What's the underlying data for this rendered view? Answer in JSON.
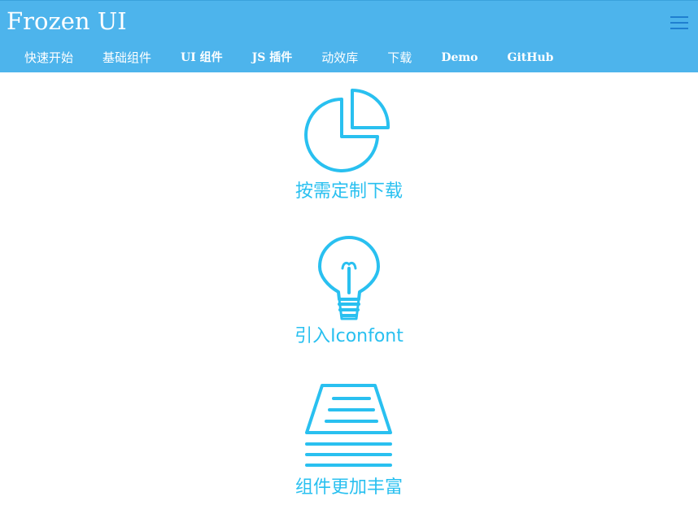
{
  "header": {
    "brand": "Frozen UI",
    "menu_icon": "hamburger-menu-icon",
    "background_color": "#4db4ec",
    "nav": [
      {
        "label": "快速开始"
      },
      {
        "label": "基础组件"
      },
      {
        "label": "UI 组件"
      },
      {
        "label": "JS 插件"
      },
      {
        "label": "动效库"
      },
      {
        "label": "下载"
      },
      {
        "label": "Demo"
      },
      {
        "label": "GitHub"
      }
    ]
  },
  "features": [
    {
      "icon": "pie-chart-icon",
      "label": "按需定制下载"
    },
    {
      "icon": "lightbulb-icon",
      "label": "引入Iconfont"
    },
    {
      "icon": "layers-stack-icon",
      "label": "组件更加丰富"
    }
  ],
  "accent_color": "#29c0f0"
}
